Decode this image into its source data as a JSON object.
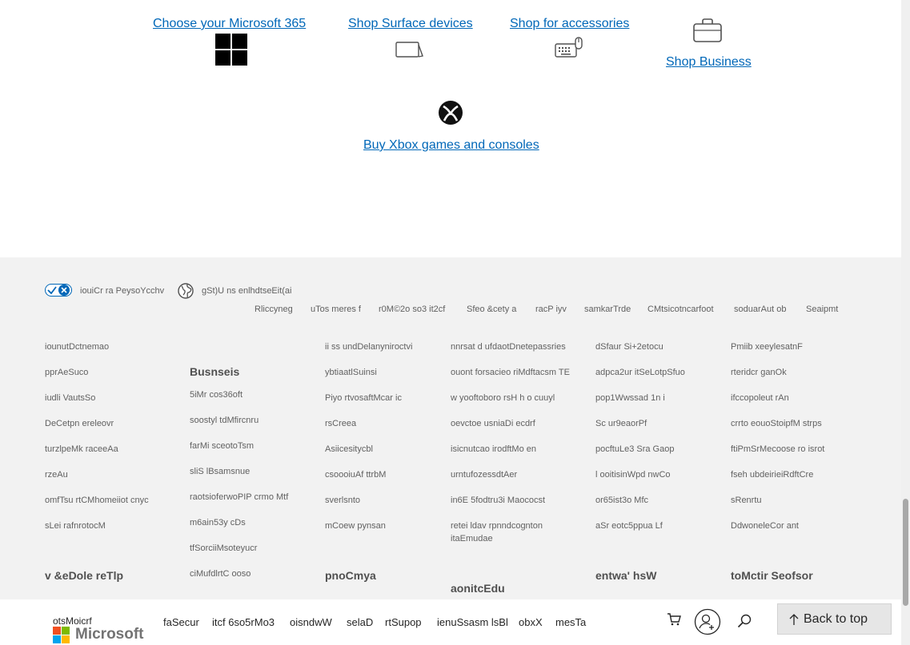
{
  "shop": {
    "m365": "Choose your Microsoft 365",
    "surface": "Shop Surface devices",
    "accessories": "Shop for accessories",
    "business": "Shop Business",
    "xbox": "Buy Xbox games and consoles"
  },
  "footer": {
    "privacy_choices": "iouiCr ra PeysoYcchv",
    "locale": "gSt)U ns enlhdtseEit(ai",
    "legal_links": [
      "Rliccyneg",
      "uTos meres f",
      "r0M©2o so3 it2cf",
      "Sfeo &cety a",
      "racP iyv",
      "samkarTrde",
      "CMtsicotncarfoot",
      "soduarAut ob",
      "Seaipmt"
    ],
    "columns": [
      {
        "items": [
          "iounutDctnemao",
          "pprAeSuco",
          "iudli VautsSo",
          "DeCetpn ereleovr",
          "turzlpeMk raceeAa",
          "rzeAu",
          "omfTsu rtCMhomeiiot cnyc",
          "sLei rafnrotocM"
        ],
        "bottom_heading": "v &eDole reTlp"
      },
      {
        "heading": "Busnseis",
        "items": [
          "5iMr cos36oft",
          "soostyl tdMfircnru",
          "farMi sceotoTsm",
          "sliS lBsamsnue",
          "raotsioferwoPIP crmo Mtf",
          "m6ain53y cDs",
          "tfSorciiMsoteyucr",
          "ciMufdlrtC ooso"
        ]
      },
      {
        "items": [
          "ii ss undDelanyniroctvi",
          "ybtiaatlSuinsi",
          "Piyo rtvosaftMcar ic",
          "rsCreea",
          "Asiicesitycbl",
          "csoooiuAf ttrbM",
          "sverlsnto",
          "mCoew pynsan"
        ],
        "bottom_heading": "pnoCmya"
      },
      {
        "items": [
          "nnrsat d ufdaotDnetepassries",
          "ouont forsacieo riMdftacsm TE",
          "w yooftoboro rsH h o cuuyl",
          "oevctoe usniaDi ecdrf",
          "isicnutcao irodftMo en",
          "urntufozessdtAer",
          "in6E 5fodtru3i Maococst"
        ],
        "last_item_lines": [
          "retei ldav rpnndcognton",
          "itaEmudae"
        ],
        "bottom_heading": "aonitcEdu"
      },
      {
        "items": [
          "dSfaur Si+2etocu",
          "adpca2ur itSeLotpSfuo",
          "pop1Wwssad 1n i",
          "Sc ur9eaorPf",
          "pocftuLe3 Sra Gaop",
          "l ooitisinWpd nwCo",
          "or65ist3o Mfc",
          "aSr eotc5ppua Lf"
        ],
        "bottom_heading": "entwa' hsW"
      },
      {
        "items": [
          "Pmiib xeeylesatnF",
          "rteridcr ganOk",
          "ifccopoleut rAn",
          "crrto eouoStoipfM strps",
          "ftiPmSrMecoose ro isrot",
          "fseh ubdeirieiRdftCre",
          "sRenrtu",
          "DdwoneleCor ant"
        ],
        "bottom_heading": "toMctir Seofsor"
      }
    ]
  },
  "bottom_bar": {
    "logo_tiny_text": "otsMoicrf",
    "logo_text": "Microsoft",
    "nav": [
      "faSecur",
      "itcf 6so5rMo3",
      "oisndwW",
      "selaD",
      "rtSupop",
      "ienuSsasm lsBl",
      "obxX",
      "mesTa"
    ],
    "back_to_top": "Back to top",
    "icons": [
      "cart-icon",
      "account-icon",
      "search-icon"
    ]
  },
  "colors": {
    "link": "#0067b8",
    "footer_bg": "#f2f2f2",
    "text_muted": "#616161"
  }
}
